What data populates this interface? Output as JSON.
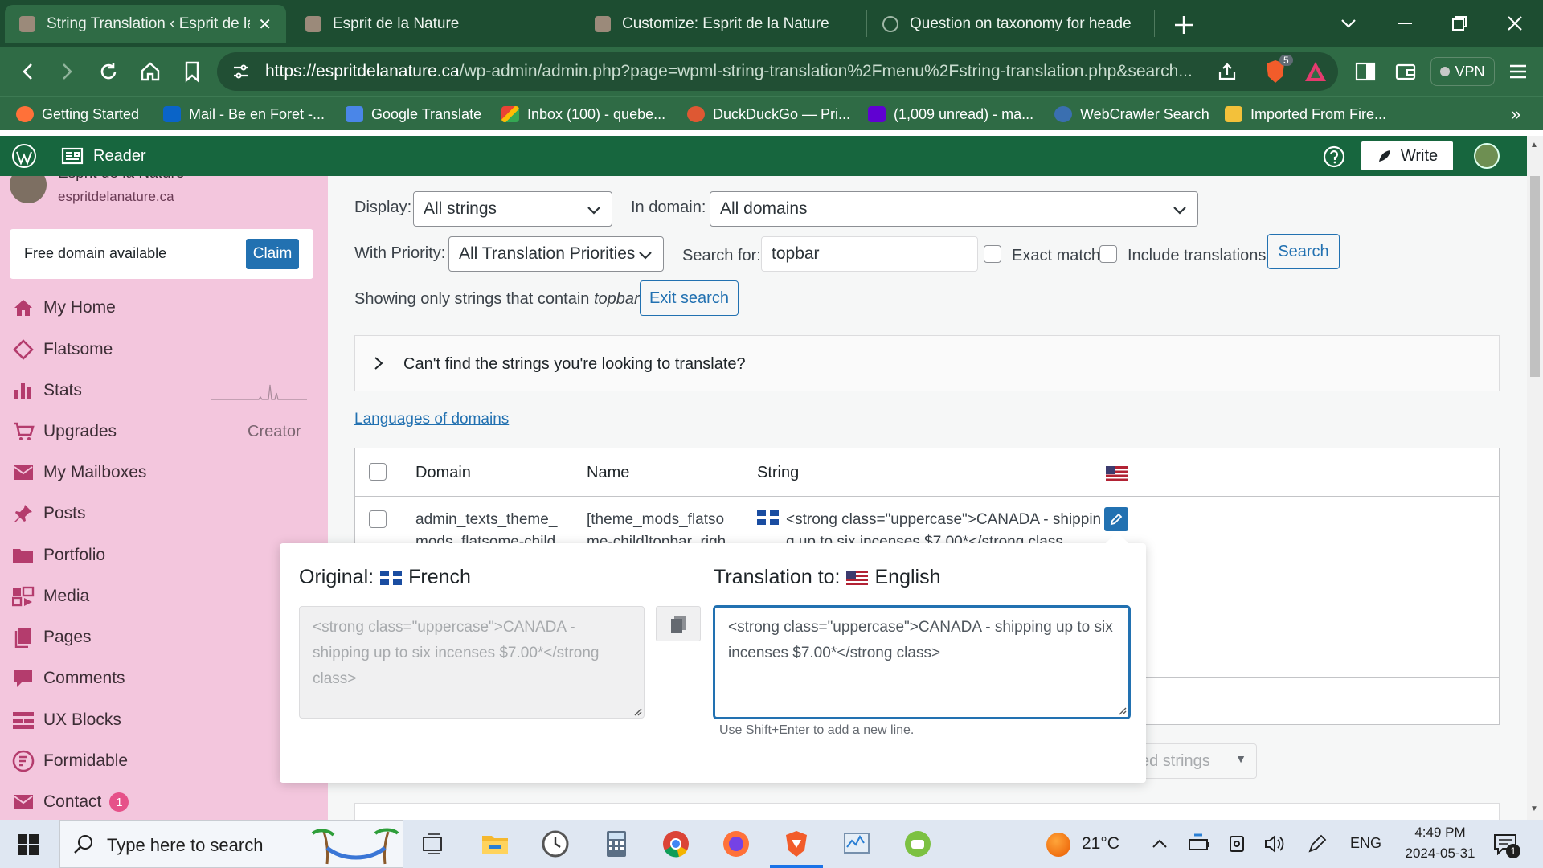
{
  "browser": {
    "tabs": [
      {
        "title": "String Translation ‹ Esprit de la Nature",
        "active": true
      },
      {
        "title": "Esprit de la Nature",
        "active": false
      },
      {
        "title": "Customize: Esprit de la Nature",
        "active": false
      },
      {
        "title": "Question on taxonomy for header m",
        "active": false
      }
    ],
    "url_domain": "https://espritdelanature.ca",
    "url_path": "/wp-admin/admin.php?page=wpml-string-translation%2Fmenu%2Fstring-translation.php&search...",
    "brave_badge": "5",
    "vpn_label": "VPN",
    "bookmarks": [
      {
        "label": "Getting Started",
        "icon": "firefox-icon",
        "color": "#ff7139"
      },
      {
        "label": "Mail - Be en Foret -...",
        "icon": "outlook-icon",
        "color": "#0a64c8"
      },
      {
        "label": "Google Translate",
        "icon": "translate-icon",
        "color": "#4a86e8"
      },
      {
        "label": "Inbox (100) - quebe...",
        "icon": "gmail-icon",
        "color": "#ffffff"
      },
      {
        "label": "DuckDuckGo — Pri...",
        "icon": "duckduckgo-icon",
        "color": "#de5833"
      },
      {
        "label": "(1,009 unread) - ma...",
        "icon": "yahoo-icon",
        "color": "#6001d2"
      },
      {
        "label": "WebCrawler Search",
        "icon": "webcrawler-icon",
        "color": "#3a6fb0"
      },
      {
        "label": "Imported From Fire...",
        "icon": "folder-icon",
        "color": "#f3c13a"
      }
    ],
    "more_bookmarks": "»"
  },
  "wpbar": {
    "reader": "Reader",
    "write": "Write"
  },
  "sidebar": {
    "site_name": "Esprit de la Nature",
    "site_url": "espritdelanature.ca",
    "free_domain": "Free domain available",
    "claim": "Claim",
    "items": [
      {
        "label": "My Home",
        "icon": "home-icon"
      },
      {
        "label": "Flatsome",
        "icon": "diamond-icon"
      },
      {
        "label": "Stats",
        "icon": "stats-icon"
      },
      {
        "label": "Upgrades",
        "icon": "cart-icon",
        "extra": "Creator"
      },
      {
        "label": "My Mailboxes",
        "icon": "mail-icon"
      },
      {
        "label": "Posts",
        "icon": "pin-icon"
      },
      {
        "label": "Portfolio",
        "icon": "folder-open-icon"
      },
      {
        "label": "Media",
        "icon": "media-icon"
      },
      {
        "label": "Pages",
        "icon": "pages-icon"
      },
      {
        "label": "Comments",
        "icon": "comment-icon"
      },
      {
        "label": "UX Blocks",
        "icon": "blocks-icon"
      },
      {
        "label": "Formidable",
        "icon": "formidable-icon"
      },
      {
        "label": "Contact",
        "icon": "mail-icon",
        "badge": "1"
      }
    ]
  },
  "filters": {
    "display_label": "Display:",
    "display_value": "All strings",
    "domain_label": "In domain:",
    "domain_value": "All domains",
    "priority_label": "With Priority:",
    "priority_value": "All Translation Priorities",
    "search_label": "Search for:",
    "search_value": "topbar",
    "exact_match": "Exact match",
    "include_translations": "Include translations",
    "search_button": "Search",
    "showing_prefix": "Showing only strings that contain",
    "showing_term": "topbar",
    "exit_search": "Exit search"
  },
  "cant_find": "Can't find the strings you're looking to translate?",
  "languages_link": "Languages of domains",
  "table": {
    "headers": {
      "domain": "Domain",
      "name": "Name",
      "string": "String"
    },
    "row": {
      "domain": "admin_texts_theme_mods_flatsome-child",
      "name": "[theme_mods_flatsome-child]topbar_righ",
      "string": "<strong class=\"uppercase\">CANADA - shipping up to six incenses $7.00*</strong class"
    }
  },
  "bulk_select_partial": "ed strings",
  "popup": {
    "original_label": "Original:",
    "original_lang": "French",
    "original_text": "<strong class=\"uppercase\">CANADA - shipping up to six incenses $7.00*</strong class>",
    "translation_label": "Translation to:",
    "translation_lang": "English",
    "translation_text": "<strong class=\"uppercase\">CANADA - shipping up to six incenses $7.00*</strong class>",
    "hint": "Use Shift+Enter to add a new line."
  },
  "taskbar": {
    "search_placeholder": "Type here to search",
    "weather": "21°C",
    "lang": "ENG",
    "time": "4:49 PM",
    "date": "2024-05-31",
    "notif_count": "1"
  },
  "colors": {
    "wp_green": "#17663e",
    "sidebar_pink": "#f3c6dd",
    "accent_blue": "#2271b1"
  }
}
